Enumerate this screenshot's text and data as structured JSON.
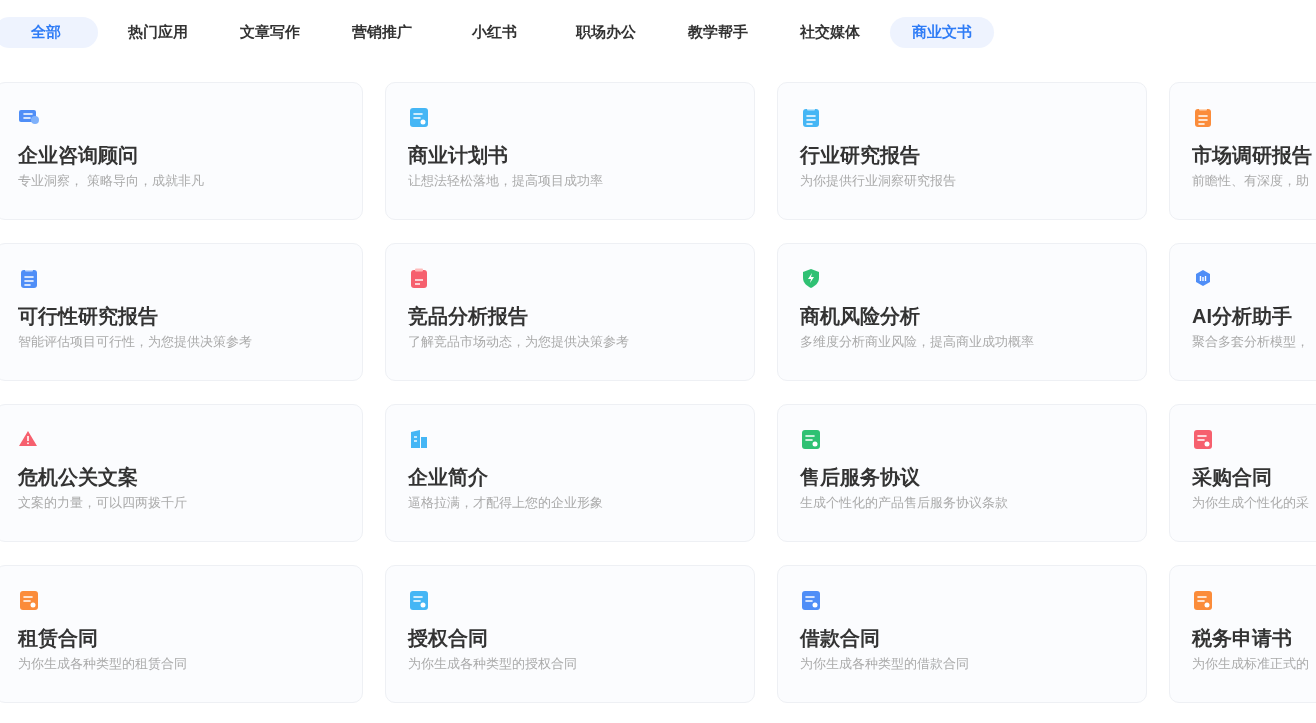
{
  "tabs": [
    {
      "label": "全部",
      "selected": true
    },
    {
      "label": "热门应用",
      "selected": false
    },
    {
      "label": "文章写作",
      "selected": false
    },
    {
      "label": "营销推广",
      "selected": false
    },
    {
      "label": "小红书",
      "selected": false
    },
    {
      "label": "职场办公",
      "selected": false
    },
    {
      "label": "教学帮手",
      "selected": false
    },
    {
      "label": "社交媒体",
      "selected": false
    },
    {
      "label": "商业文书",
      "selected": true
    }
  ],
  "cards": [
    {
      "title": "企业咨询顾问",
      "description": "专业洞察， 策略导向，成就非凡",
      "kind": "monitor",
      "color": "#4f8ef7"
    },
    {
      "title": "商业计划书",
      "description": "让想法轻松落地，提高项目成功率",
      "kind": "note",
      "color": "#45b6f5"
    },
    {
      "title": "行业研究报告",
      "description": "为你提供行业洞察研究报告",
      "kind": "clipboard",
      "color": "#45b6f5"
    },
    {
      "title": "市场调研报告",
      "description": "前瞻性、有深度，助",
      "kind": "clipboard",
      "color": "#fb8c3a"
    },
    {
      "title": "可行性研究报告",
      "description": "智能评估项目可行性，为您提供决策参考",
      "kind": "clipboard",
      "color": "#4f8ef7"
    },
    {
      "title": "竞品分析报告",
      "description": "了解竞品市场动态，为您提供决策参考",
      "kind": "vs",
      "color": "#f6606e"
    },
    {
      "title": "商机风险分析",
      "description": "多维度分析商业风险，提高商业成功概率",
      "kind": "shield",
      "color": "#2fc173"
    },
    {
      "title": "AI分析助手",
      "description": "聚合多套分析模型，",
      "kind": "hexagon",
      "color": "#4f8ef7"
    },
    {
      "title": "危机公关文案",
      "description": "文案的力量，可以四两拨千斤",
      "kind": "warning",
      "color": "#f6606e"
    },
    {
      "title": "企业简介",
      "description": "逼格拉满，才配得上您的企业形象",
      "kind": "building",
      "color": "#45b6f5"
    },
    {
      "title": "售后服务协议",
      "description": "生成个性化的产品售后服务协议条款",
      "kind": "document",
      "color": "#2fc173"
    },
    {
      "title": "采购合同",
      "description": "为你生成个性化的采",
      "kind": "document",
      "color": "#f6606e"
    },
    {
      "title": "租赁合同",
      "description": "为你生成各种类型的租赁合同",
      "kind": "document",
      "color": "#fb8c3a"
    },
    {
      "title": "授权合同",
      "description": "为你生成各种类型的授权合同",
      "kind": "document",
      "color": "#45b6f5"
    },
    {
      "title": "借款合同",
      "description": "为你生成各种类型的借款合同",
      "kind": "document",
      "color": "#4f8ef7"
    },
    {
      "title": "税务申请书",
      "description": "为你生成标准正式的",
      "kind": "document",
      "color": "#fb8c3a"
    }
  ]
}
